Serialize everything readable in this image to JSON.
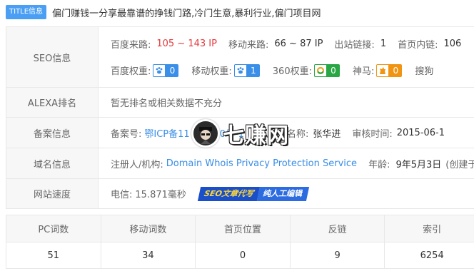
{
  "title": {
    "badge": "TITLE信息",
    "text": "偏门赚钱一分享最靠谱的挣钱门路,冷门生意,暴利行业,偏门项目网"
  },
  "seo": {
    "label": "SEO信息",
    "baidu_traffic_label": "百度来路:",
    "baidu_traffic_value": "105 ~ 143 IP",
    "mobile_traffic_label": "移动来路:",
    "mobile_traffic_value": "66 ~ 87 IP",
    "outlinks_label": "出站链接:",
    "outlinks_value": "1",
    "homepage_links_label": "首页内链:",
    "homepage_links_value": "106",
    "baidu_weight_label": "百度权重:",
    "baidu_weight_value": "0",
    "mobile_weight_label": "移动权重:",
    "mobile_weight_value": "1",
    "w360_label": "360权重:",
    "w360_value": "0",
    "shenma_label": "神马:",
    "shenma_value": "0",
    "sogou_label": "搜狗"
  },
  "alexa": {
    "label": "ALEXA排名",
    "value": "暂无排名或相关数据不充分"
  },
  "icp": {
    "label": "备案信息",
    "no_label": "备案号:",
    "no_value": "鄂ICP备11",
    "no_suffix": "0号-1",
    "type_value": "个人",
    "name_label": "名称:",
    "name_value": "张华进",
    "audit_label": "审核时间:",
    "audit_value": "2015-06-1"
  },
  "domain": {
    "label": "域名信息",
    "registrant_label": "注册人/机构:",
    "registrant_value": "Domain Whois Privacy Protection Service",
    "age_label": "年龄:",
    "age_value": "9年5月3日",
    "created_value": "(创建于20"
  },
  "speed": {
    "label": "网站速度",
    "telecom_label": "电信:",
    "telecom_value": "15.871毫秒",
    "badge_a": "SEO文章代写",
    "badge_b": "纯人工编辑"
  },
  "watermark": {
    "text": "七赚网"
  },
  "stats": {
    "headers": [
      "PC词数",
      "移动词数",
      "首页位置",
      "反链",
      "索引"
    ],
    "values": [
      "51",
      "34",
      "0",
      "9",
      "6254"
    ]
  },
  "colors": {
    "accent_blue": "#3a8fe8",
    "green": "#29a744",
    "orange": "#f19412",
    "red": "#e4393c"
  }
}
